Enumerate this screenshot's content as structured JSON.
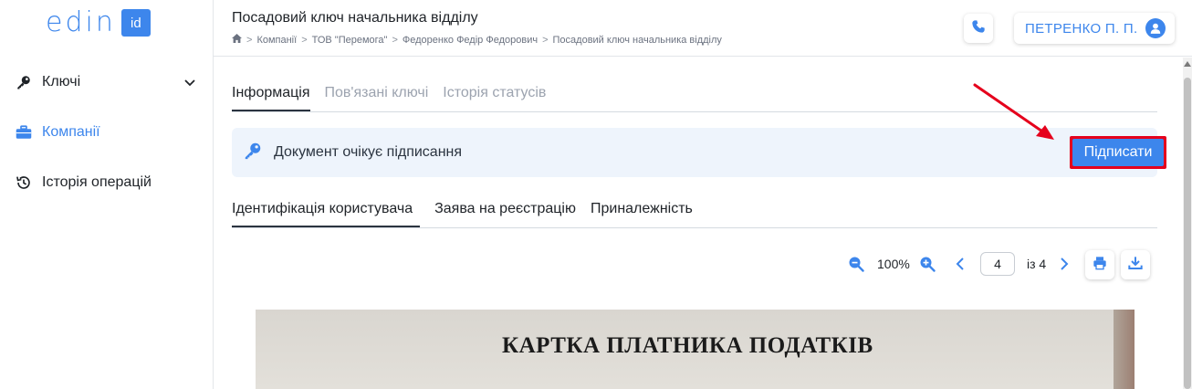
{
  "logo": {
    "text": "edin",
    "badge": "id"
  },
  "sidebar": {
    "items": [
      {
        "label": "Ключі",
        "icon": "key-icon",
        "expandable": true
      },
      {
        "label": "Компанії",
        "icon": "briefcase-icon",
        "active": true
      },
      {
        "label": "Історія операцій",
        "icon": "history-icon"
      }
    ]
  },
  "header": {
    "title": "Посадовий ключ начальника відділу",
    "breadcrumb": [
      "Компанії",
      "ТОВ \"Перемога\"",
      "Федоренко Федір Федорович",
      "Посадовий ключ начальника відділу"
    ],
    "user_name": "ПЕТРЕНКО П. П."
  },
  "tabs": [
    {
      "label": "Інформація",
      "active": true
    },
    {
      "label": "Пов'язані ключі",
      "active": false
    },
    {
      "label": "Історія статусів",
      "active": false
    }
  ],
  "banner": {
    "text": "Документ очікує підписання",
    "sign_label": "Підписати"
  },
  "sub_tabs": [
    {
      "label": "Ідентифікація користувача",
      "active": true
    },
    {
      "label": "Заява на реєстрацію",
      "active": false
    },
    {
      "label": "Приналежність",
      "active": false
    }
  ],
  "viewer": {
    "zoom": "100%",
    "page": "4",
    "of_pages": "із 4"
  },
  "document": {
    "heading": "КАРТКА ПЛАТНИКА ПОДАТКІВ"
  },
  "colors": {
    "accent": "#3d86ec",
    "annotation": "#e5001c",
    "banner_bg": "#eef4fc"
  }
}
